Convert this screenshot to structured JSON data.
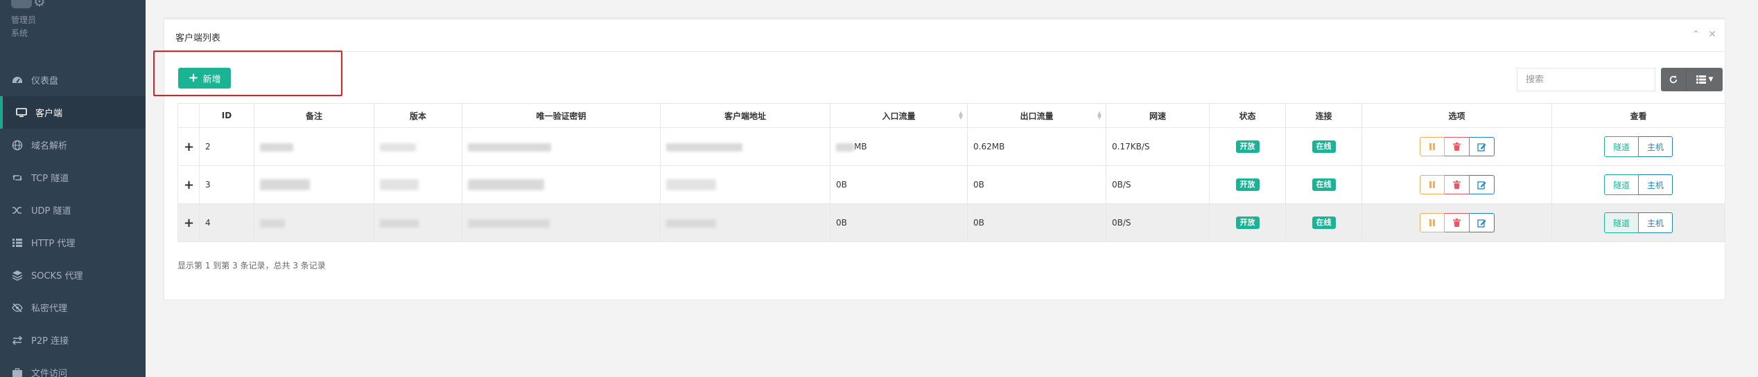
{
  "sidebar": {
    "role": "管理员",
    "system": "系统",
    "items": [
      {
        "label": "仪表盘",
        "icon": "dashboard-icon"
      },
      {
        "label": "客户端",
        "icon": "desktop-icon",
        "active": true
      },
      {
        "label": "域名解析",
        "icon": "globe-icon"
      },
      {
        "label": "TCP 隧道",
        "icon": "retweet-icon"
      },
      {
        "label": "UDP 隧道",
        "icon": "random-icon"
      },
      {
        "label": "HTTP 代理",
        "icon": "list-icon"
      },
      {
        "label": "SOCKS 代理",
        "icon": "layers-icon"
      },
      {
        "label": "私密代理",
        "icon": "eye-slash-icon"
      },
      {
        "label": "P2P 连接",
        "icon": "exchange-icon"
      },
      {
        "label": "文件访问",
        "icon": "briefcase-icon"
      }
    ]
  },
  "panel": {
    "title": "客户端列表",
    "add_label": "新增",
    "search_placeholder": "搜索"
  },
  "table": {
    "headers": [
      "",
      "ID",
      "备注",
      "版本",
      "唯一验证密钥",
      "客户端地址",
      "入口流量",
      "出口流量",
      "网速",
      "状态",
      "连接",
      "选项",
      "查看"
    ],
    "rows": [
      {
        "id": "2",
        "in_flow": "MB",
        "out_flow": "0.62MB",
        "speed": "0.17KB/S",
        "status": "开放",
        "conn": "在线"
      },
      {
        "id": "3",
        "in_flow": "0B",
        "out_flow": "0B",
        "speed": "0B/S",
        "status": "开放",
        "conn": "在线"
      },
      {
        "id": "4",
        "in_flow": "0B",
        "out_flow": "0B",
        "speed": "0B/S",
        "status": "开放",
        "conn": "在线"
      }
    ],
    "view_tunnel": "隧道",
    "view_host": "主机"
  },
  "footer": "显示第 1 到第 3 条记录，总共 3 条记录",
  "colors": {
    "sidebar": "#2f4050",
    "primary": "#1ab394",
    "info": "#1c84c6",
    "warning": "#f8ac59",
    "danger": "#ed5565",
    "highlight_box": "#e02020"
  }
}
